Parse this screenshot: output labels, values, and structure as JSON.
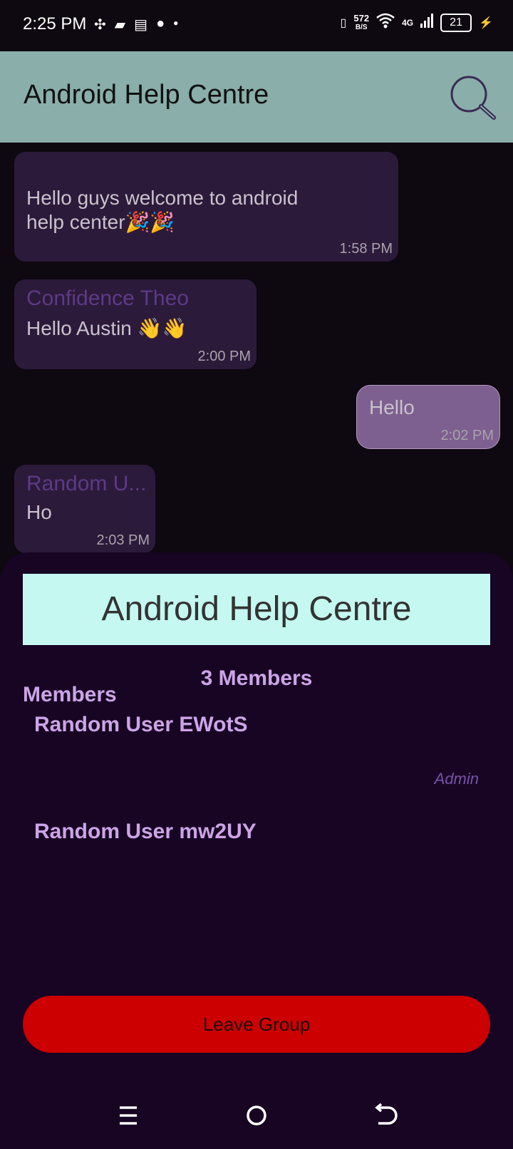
{
  "status_bar": {
    "time": "2:25 PM",
    "net_speed_value": "572",
    "net_speed_unit": "B/S",
    "network_type": "4G",
    "battery": "21"
  },
  "app_bar": {
    "title": "Android Help Centre",
    "search_icon": "search-icon"
  },
  "chat": {
    "messages": [
      {
        "sender": "",
        "text": "Hello guys welcome to android help center🎉🎉",
        "time": "1:58 PM"
      },
      {
        "sender": "Confidence Theo",
        "text": "Hello Austin 👋👋",
        "time": "2:00 PM"
      },
      {
        "sender": "",
        "text": "Hello",
        "time": "2:02 PM"
      },
      {
        "sender": "Random U...",
        "text": "Ho",
        "time": "2:03 PM"
      }
    ]
  },
  "group_info": {
    "title": "Android Help Centre",
    "member_count": "3 Members",
    "members_label": "Members",
    "members": [
      {
        "name": "Random User EWotS",
        "role": "Admin"
      },
      {
        "name": "Random User mw2UY",
        "role": ""
      }
    ],
    "leave_label": "Leave Group"
  },
  "colors": {
    "app_bar": "#8aaea9",
    "sheet": "#170523",
    "accent": "#cda4e7",
    "leave": "#cc0000",
    "header_bg": "#c5f8f0"
  },
  "nav_bar": {
    "icons": [
      "menu-icon",
      "home-icon",
      "back-icon"
    ]
  }
}
